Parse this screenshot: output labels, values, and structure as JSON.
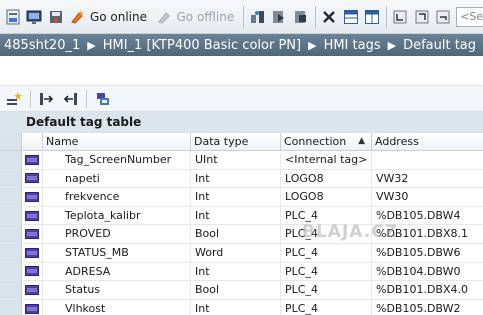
{
  "toolbar": {
    "go_online_label": "Go online",
    "go_offline_label": "Go offline",
    "search_placeholder": "<Se"
  },
  "breadcrumb": {
    "items": [
      "485sht20_1",
      "HMI_1 [KTP400 Basic color PN]",
      "HMI tags",
      "Default tag"
    ]
  },
  "table": {
    "title": "Default tag table",
    "columns": {
      "name": "Name",
      "data_type": "Data type",
      "connection": "Connection",
      "address": "Address"
    },
    "sorted_column": "connection",
    "rows": [
      {
        "name": "Tag_ScreenNumber",
        "data_type": "UInt",
        "connection": "<Internal tag>",
        "address": ""
      },
      {
        "name": "napeti",
        "data_type": "Int",
        "connection": "LOGO8",
        "address": "VW32"
      },
      {
        "name": "frekvence",
        "data_type": "Int",
        "connection": "LOGO8",
        "address": "VW30"
      },
      {
        "name": "Teplota_kalibr",
        "data_type": "Int",
        "connection": "PLC_4",
        "address": "%DB105.DBW4"
      },
      {
        "name": "PROVED",
        "data_type": "Bool",
        "connection": "PLC_4",
        "address": "%DB101.DBX8.1"
      },
      {
        "name": "STATUS_MB",
        "data_type": "Word",
        "connection": "PLC_4",
        "address": "%DB105.DBW6"
      },
      {
        "name": "ADRESA",
        "data_type": "Int",
        "connection": "PLC_4",
        "address": "%DB104.DBW0"
      },
      {
        "name": "Status",
        "data_type": "Bool",
        "connection": "PLC_4",
        "address": "%DB101.DBX4.0"
      },
      {
        "name": "Vlhkost",
        "data_type": "Int",
        "connection": "PLC_4",
        "address": "%DB105.DBW2"
      }
    ]
  },
  "watermark": "BLAJA.CZ",
  "colors": {
    "breadcrumb_bg": "#5a7487",
    "tag_icon": "#4b3fa8",
    "header_bg": "#dde5ec"
  }
}
